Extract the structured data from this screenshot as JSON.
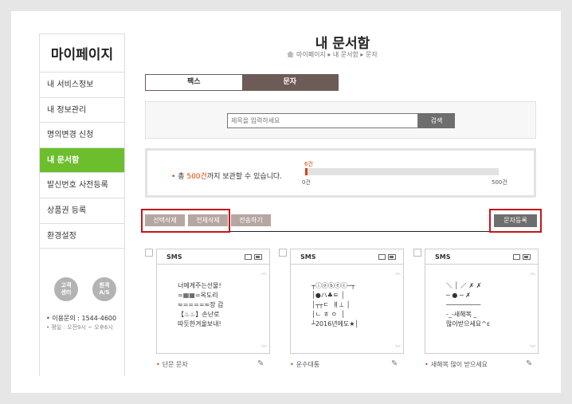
{
  "sidebar": {
    "title": "마이페이지",
    "items": [
      {
        "label": "내 서비스정보",
        "active": false
      },
      {
        "label": "내 정보관리",
        "active": false
      },
      {
        "label": "명의변경 신청",
        "active": false
      },
      {
        "label": "내 문서함",
        "active": true
      },
      {
        "label": "발신번호 사전등록",
        "active": false
      },
      {
        "label": "상품권 등록",
        "active": false
      },
      {
        "label": "환경설정",
        "active": false
      }
    ],
    "support_btn": "고객\n센터",
    "remote_btn": "원격\nA/S",
    "phone": "이용문의 : 1544-4600",
    "hours": "평일 : 오전9시 ~ 오후6시"
  },
  "header": {
    "title": "내 문서함",
    "breadcrumb": "마이페이지 ▸ 내 문서함 ▸ 문자"
  },
  "tabs": {
    "fax": "팩스",
    "sms": "문자",
    "active": "sms"
  },
  "search": {
    "placeholder": "제목을 입력하세요",
    "button": "검색"
  },
  "storage": {
    "prefix": "총 ",
    "limit": "500건",
    "suffix": "까지 보관할 수 있습니다.",
    "used": "6건",
    "used_value": 6,
    "max_value": 500,
    "min_label": "0건",
    "max_label": "500건"
  },
  "actions": {
    "delete_selected": "선택삭제",
    "delete_all": "전체삭제",
    "send": "전송하기",
    "register": "문자등록"
  },
  "cards": [
    {
      "type": "SMS",
      "name": "단문 문자",
      "message": "너에게주는선물!\n=▦▦=옥도리\n≈====≈장 갑\n【♨♨】손난로\n따듯한겨울보내!"
    },
    {
      "type": "SMS",
      "name": "운수대통",
      "message": "┬ⓘⓞⓑⓔⓒ─┬\n│●ハ♣ㅌ │\n│┬┬ㄷ  ㅒ⊥ │\n│ㄴ ㅎ ㅇ  │\n┴2016년에도★│"
    },
    {
      "type": "SMS",
      "name": "새해복 많이 받으세요",
      "message": "＼ │ ／ ✗ ✗\n─ ● ─ ✗\n─────────\n-_-새해복 _\n많이받으세요^ε"
    }
  ],
  "colors": {
    "accent_green": "#6cbe2d",
    "tab_brown": "#6d5b58",
    "highlight_red": "#c4161c",
    "text_red": "#e04000"
  }
}
